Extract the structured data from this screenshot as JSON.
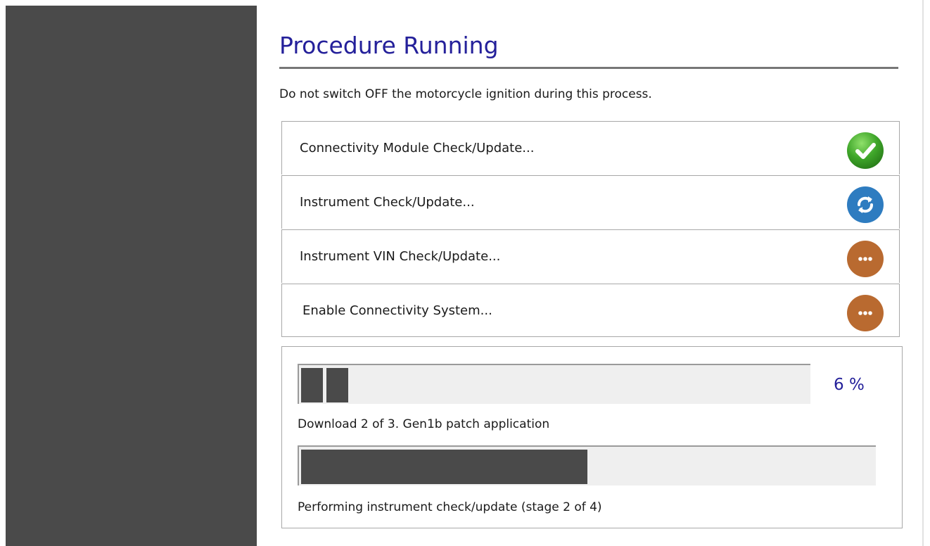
{
  "header": {
    "title": "Procedure Running",
    "warning": "Do not switch OFF the motorcycle ignition during this process."
  },
  "steps": [
    {
      "label": "Connectivity Module Check/Update...",
      "status": "complete",
      "icon": "checkmark-icon",
      "color": "#3fa62a"
    },
    {
      "label": "Instrument Check/Update...",
      "status": "in-progress",
      "icon": "sync-icon",
      "color": "#2e7cc0"
    },
    {
      "label": "Instrument VIN Check/Update...",
      "status": "pending",
      "icon": "ellipsis-icon",
      "color": "#b96a30"
    },
    {
      "label": "Enable Connectivity System...",
      "status": "pending",
      "icon": "ellipsis-icon",
      "color": "#b96a30"
    }
  ],
  "progress": {
    "download": {
      "percent": 6,
      "percent_text": "6",
      "percent_unit": "%",
      "caption": "Download 2 of 3. Gen1b patch application"
    },
    "overall": {
      "fraction": 0.5,
      "caption": "Performing instrument check/update (stage 2 of 4)"
    }
  },
  "colors": {
    "title": "#24209a",
    "sidebar": "#4a4a4a",
    "bar_fill": "#4a4a4a",
    "bar_track": "#efefef"
  }
}
